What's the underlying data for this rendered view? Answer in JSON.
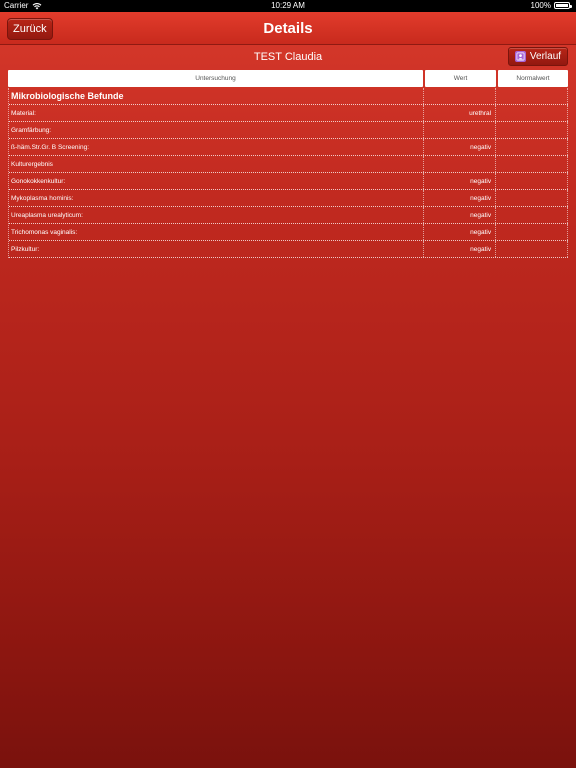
{
  "status_bar": {
    "carrier": "Carrier",
    "time": "10:29 AM",
    "battery": "100%"
  },
  "nav": {
    "back_label": "Zurück",
    "title": "Details"
  },
  "patient": {
    "name": "TEST Claudia"
  },
  "verlauf_button": {
    "label": "Verlauf",
    "icon": "person-icon",
    "icon_color": "#a864d6"
  },
  "table": {
    "headers": [
      "Untersuchung",
      "Wert",
      "Normalwert"
    ],
    "section_title": "Mikrobiologische Befunde",
    "rows": [
      {
        "name": "Material:",
        "value": "urethral",
        "normal": ""
      },
      {
        "name": "Gramfärbung:",
        "value": "",
        "normal": ""
      },
      {
        "name": "ß-häm.Str.Gr. B Screening:",
        "value": "negativ",
        "normal": ""
      },
      {
        "name": "Kulturergebnis",
        "value": "",
        "normal": ""
      },
      {
        "name": "Gonokokkenkultur:",
        "value": "negativ",
        "normal": ""
      },
      {
        "name": "Mykoplasma hominis:",
        "value": "negativ",
        "normal": ""
      },
      {
        "name": "Ureaplasma urealyticum:",
        "value": "negativ",
        "normal": ""
      },
      {
        "name": "Trichomonas vaginalis:",
        "value": "negativ",
        "normal": ""
      },
      {
        "name": "Pilzkultur:",
        "value": "negativ",
        "normal": ""
      }
    ]
  },
  "colors": {
    "accent": "#c82a1d",
    "background_top": "#d83a2c",
    "background_bottom": "#7a120d"
  }
}
